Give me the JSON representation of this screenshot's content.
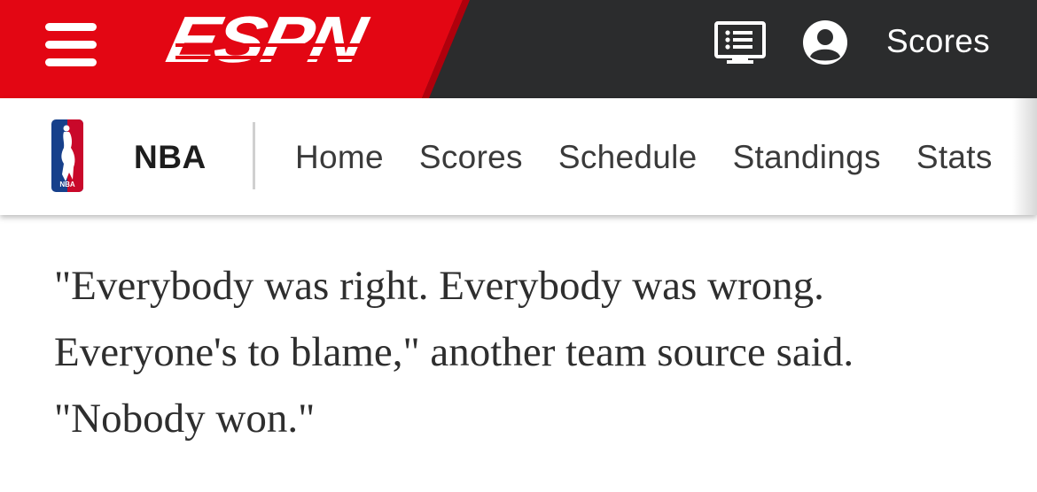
{
  "header": {
    "logo_text": "ESPN",
    "scores_label": "Scores",
    "colors": {
      "brand_red": "#e30613",
      "bar_dark": "#2b2c2d"
    },
    "icons": [
      "menu-icon",
      "watch-icon",
      "account-icon"
    ]
  },
  "subnav": {
    "league": "NBA",
    "items": [
      "Home",
      "Scores",
      "Schedule",
      "Standings",
      "Stats"
    ]
  },
  "article": {
    "paragraph": "\"Everybody was right. Everybody was wrong. Everyone's to blame,\" another team source said. \"Nobody won.\""
  }
}
